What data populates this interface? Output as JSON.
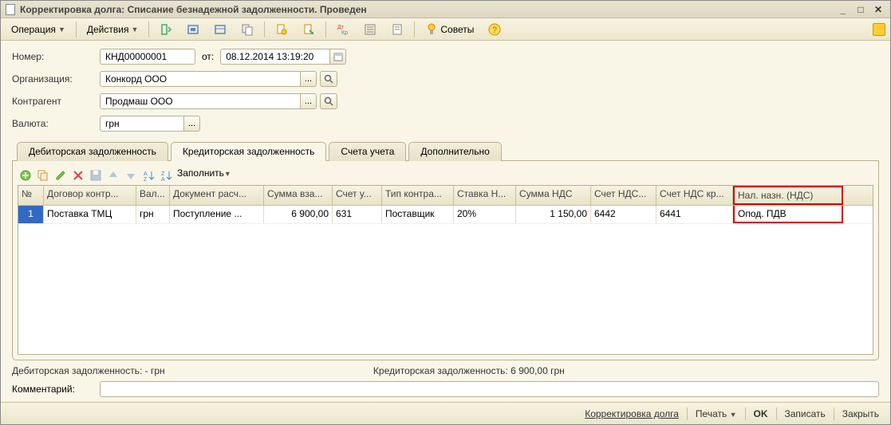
{
  "window": {
    "title": "Корректировка долга: Списание безнадежной задолженности. Проведен"
  },
  "menu": {
    "operation": "Операция",
    "actions": "Действия",
    "tips": "Советы"
  },
  "form": {
    "number_label": "Номер:",
    "number_value": "КНД00000001",
    "date_label": "от:",
    "date_value": "08.12.2014 13:19:20",
    "org_label": "Организация:",
    "org_value": "Конкорд ООО",
    "contr_label": "Контрагент",
    "contr_value": "Продмаш ООО",
    "currency_label": "Валюта:",
    "currency_value": "грн"
  },
  "tabs": {
    "t1": "Дебиторская задолженность",
    "t2": "Кредиторская задолженность",
    "t3": "Счета учета",
    "t4": "Дополнительно"
  },
  "grid_toolbar": {
    "fill": "Заполнить"
  },
  "grid": {
    "headers": {
      "n": "N",
      "n_header": "№",
      "contract": "Договор контр...",
      "cur": "Вал...",
      "doc": "Документ расч...",
      "sum": "Сумма вза...",
      "acc": "Счет у...",
      "type": "Тип контра...",
      "rate": "Ставка Н...",
      "nds": "Сумма НДС",
      "accnds": "Счет  НДС...",
      "accndskr": "Счет  НДС кр...",
      "nazn": "Нал. назн. (НДС)"
    },
    "rows": [
      {
        "n": "1",
        "contract": "Поставка ТМЦ",
        "cur": "грн",
        "doc": "Поступление ...",
        "sum": "6 900,00",
        "acc": "631",
        "type": "Поставщик",
        "rate": "20%",
        "nds": "1 150,00",
        "accnds": "6442",
        "accndskr": "6441",
        "nazn": "Опод. ПДВ"
      }
    ]
  },
  "summary": {
    "debit": "Дебиторская задолженность: - грн",
    "credit": "Кредиторская задолженность: 6 900,00 грн"
  },
  "comment_label": "Комментарий:",
  "comment_value": "",
  "bottom": {
    "link1": "Корректировка долга",
    "print": "Печать",
    "ok": "OK",
    "save": "Записать",
    "close": "Закрыть"
  },
  "col_widths": {
    "n": 32,
    "contract": 116,
    "cur": 42,
    "doc": 118,
    "sum": 86,
    "acc": 62,
    "type": 90,
    "rate": 78,
    "nds": 94,
    "accnds": 82,
    "accndskr": 96,
    "nazn": 138
  }
}
